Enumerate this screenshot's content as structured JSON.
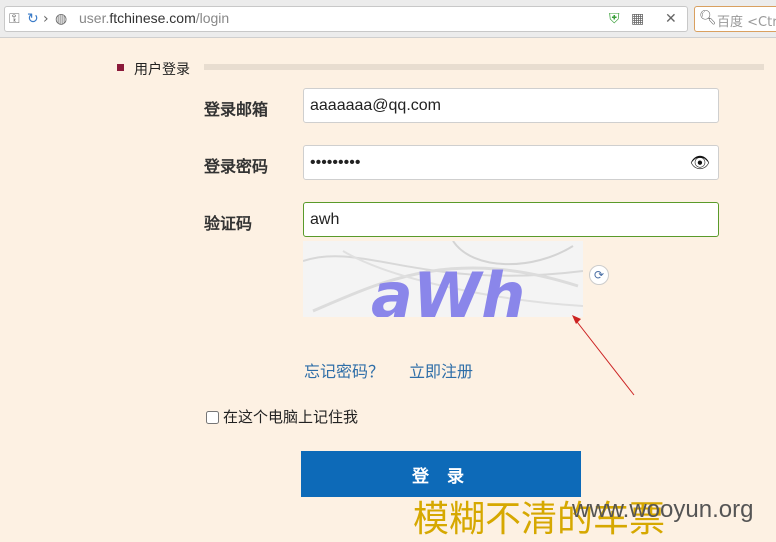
{
  "browser": {
    "url_prefix": "user.",
    "url_host": "ftchinese.com",
    "url_path": "/login",
    "search_placeholder": "百度 <Ctrl+K>"
  },
  "section": {
    "title": "用户登录"
  },
  "form": {
    "email_label": "登录邮箱",
    "email_value": "aaaaaaa@qq.com",
    "password_label": "登录密码",
    "password_value": "•••••••••",
    "captcha_label": "验证码",
    "captcha_value": "awh",
    "captcha_image_text": "aWh"
  },
  "links": {
    "forgot": "忘记密码？",
    "register": "立即注册"
  },
  "remember_label": "在这个电脑上记住我",
  "login_button": "登 录",
  "watermark": {
    "chinese": "模糊不清的车票",
    "english": "www.wooyun.org"
  },
  "colors": {
    "accent": "#0d6ab8",
    "section_marker": "#8b1a3a",
    "watermark": "#d6a800"
  }
}
